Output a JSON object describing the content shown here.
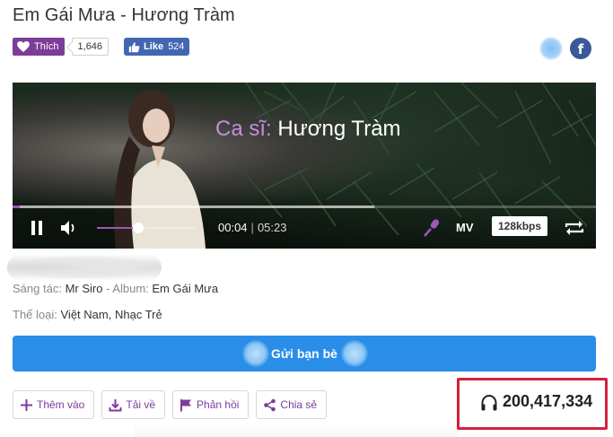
{
  "song": {
    "title": "Em Gái Mưa",
    "separator": " - ",
    "artist": "Hương Tràm"
  },
  "social": {
    "thich_label": "Thích",
    "thich_count": "1,646",
    "fb_like_label": "Like",
    "fb_like_count": "524",
    "facebook_letter": "f"
  },
  "player": {
    "caption_prefix": "Ca sĩ:",
    "caption_name": "Hương Tràm",
    "current_time": "00:04",
    "time_separator": "|",
    "duration": "05:23",
    "progress_fraction": 0.012,
    "buffer_fraction": 0.62,
    "volume_fraction": 0.42,
    "mv_label": "MV",
    "quality_label": "128kbps",
    "icons": [
      "pause-icon",
      "volume-icon",
      "microphone-icon",
      "repeat-icon"
    ]
  },
  "meta": {
    "composer_label": "Sáng tác:",
    "composer": "Mr Siro",
    "album_label": "Album:",
    "album": "Em Gái Mưa",
    "genre_label": "Thể loại:",
    "genre_1": "Việt Nam",
    "genre_2": "Nhạc Trẻ"
  },
  "send_button_label": "Gửi bạn bè",
  "actions": [
    {
      "label": "Thêm vào",
      "icon": "plus-icon"
    },
    {
      "label": "Tải về",
      "icon": "download-icon"
    },
    {
      "label": "Phản hồi",
      "icon": "flag-icon"
    },
    {
      "label": "Chia sẻ",
      "icon": "share-icon"
    }
  ],
  "listen_count": "200,417,334",
  "colors": {
    "accent_purple": "#7d3c98",
    "facebook_blue": "#4267b2",
    "send_blue": "#2a8ee8",
    "highlight_red": "#d4213d"
  }
}
